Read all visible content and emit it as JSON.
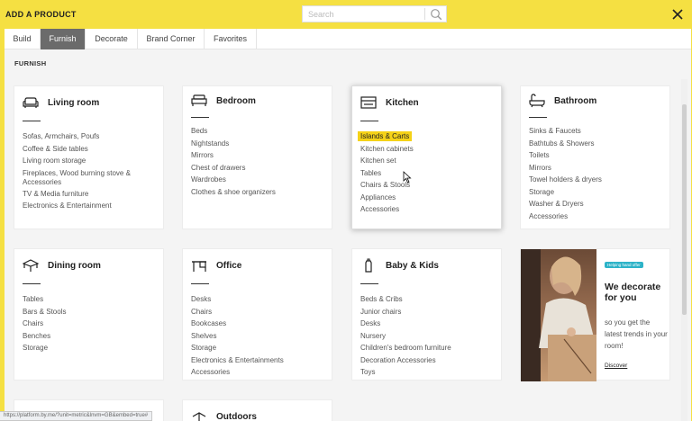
{
  "header": {
    "title": "ADD A PRODUCT",
    "search_placeholder": "Search"
  },
  "tabs": [
    {
      "label": "Build",
      "active": false
    },
    {
      "label": "Furnish",
      "active": true
    },
    {
      "label": "Decorate",
      "active": false
    },
    {
      "label": "Brand Corner",
      "active": false
    },
    {
      "label": "Favorites",
      "active": false
    }
  ],
  "section_label": "FURNISH",
  "categories": [
    {
      "title": "Living room",
      "icon": "sofa-icon",
      "items": [
        "Sofas, Armchairs, Poufs",
        "Coffee & Side tables",
        "Living room storage",
        "Fireplaces, Wood burning stove & Accessories",
        "TV & Media furniture",
        "Electronics & Entertainment"
      ]
    },
    {
      "title": "Bedroom",
      "icon": "bed-icon",
      "items": [
        "Beds",
        "Nightstands",
        "Mirrors",
        "Chest of drawers",
        "Wardrobes",
        "Clothes & shoe organizers"
      ]
    },
    {
      "title": "Kitchen",
      "icon": "kitchen-stove-icon",
      "items": [
        "Islands & Carts",
        "Kitchen cabinets",
        "Kitchen set",
        "Tables",
        "Chairs & Stools",
        "Appliances",
        "Accessories"
      ],
      "selected_item": "Islands & Carts"
    },
    {
      "title": "Bathroom",
      "icon": "bathtub-icon",
      "items": [
        "Sinks & Faucets",
        "Bathtubs & Showers",
        "Toilets",
        "Mirrors",
        "Towel holders & dryers",
        "Storage",
        "Washer & Dryers",
        "Accessories"
      ]
    },
    {
      "title": "Dining room",
      "icon": "dining-table-icon",
      "items": [
        "Tables",
        "Bars & Stools",
        "Chairs",
        "Benches",
        "Storage"
      ]
    },
    {
      "title": "Office",
      "icon": "desk-icon",
      "items": [
        "Desks",
        "Chairs",
        "Bookcases",
        "Shelves",
        "Storage",
        "Electronics & Entertainments",
        "Accessories"
      ]
    },
    {
      "title": "Baby & Kids",
      "icon": "baby-bottle-icon",
      "items": [
        "Beds & Cribs",
        "Junior chairs",
        "Desks",
        "Nursery",
        "Children's bedroom furniture",
        "Decoration Accessories",
        "Toys"
      ]
    },
    {
      "title": "Outdoors",
      "icon": "outdoor-icon",
      "items": []
    }
  ],
  "promo": {
    "badge": "Helping hand offer",
    "headline": "We decorate for you",
    "body": "so you get the latest trends in your room!",
    "link": "Discover"
  },
  "statusbar": {
    "url": "https://platform.by.me/?unit=metric&lnvm=GB&embed=true#"
  },
  "colors": {
    "accent_yellow": "#f5e042",
    "selected_highlight": "#f5d218",
    "active_tab": "#6b6b6b",
    "badge": "#2db3c8"
  }
}
